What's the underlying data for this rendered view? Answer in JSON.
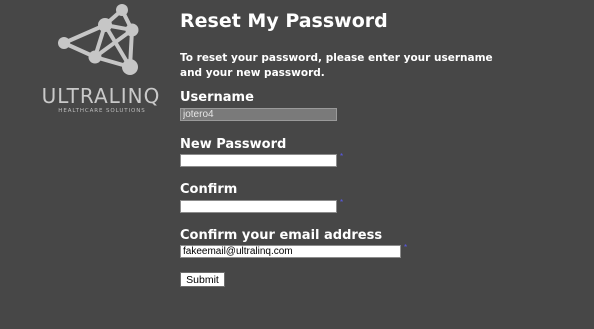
{
  "brand": {
    "name": "ULTRALINQ",
    "tagline": "HEALTHCARE SOLUTIONS"
  },
  "page": {
    "title": "Reset My Password",
    "instructions": "To reset your password, please enter your username and your new password."
  },
  "form": {
    "username_label": "Username",
    "username_value": "jotero4",
    "new_password_label": "New Password",
    "new_password_value": "",
    "confirm_label": "Confirm",
    "confirm_value": "",
    "email_label": "Confirm your email address",
    "email_value": "fakeemail@ultralinq.com",
    "required_marker": "*",
    "submit_label": "Submit"
  },
  "icons": {
    "logo": "network-nodes-logo-icon"
  },
  "colors": {
    "background": "#474747",
    "text": "#ffffff",
    "logo": "#c9c9c9",
    "required": "#5a5af0"
  }
}
